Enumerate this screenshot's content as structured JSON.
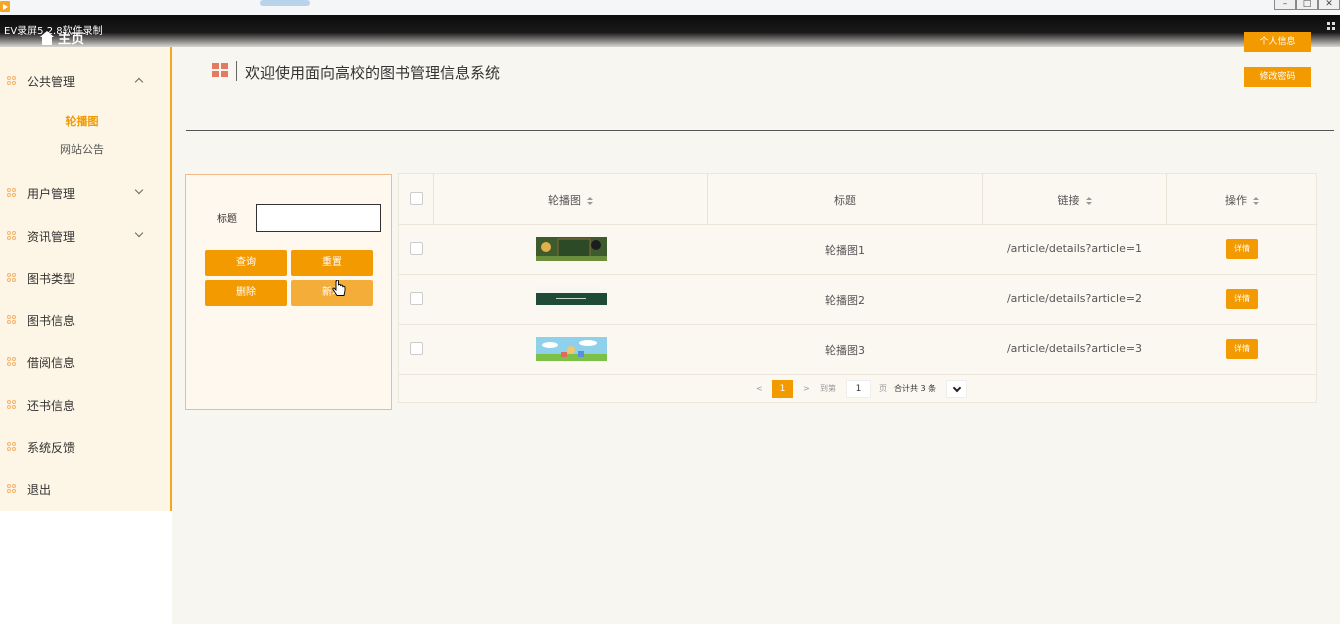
{
  "recorder": {
    "label": "EV录屏5.2.8软件录制"
  },
  "header": {
    "home_label": "主页",
    "title": "欢迎使用面向高校的图书管理信息系统",
    "profile_button": "个人信息",
    "password_button": "修改密码"
  },
  "sidebar": {
    "items": [
      {
        "label": "公共管理",
        "expanded": true,
        "children": [
          "轮播图",
          "网站公告"
        ],
        "active_child": "轮播图"
      },
      {
        "label": "用户管理",
        "expanded": false
      },
      {
        "label": "资讯管理",
        "expanded": false
      },
      {
        "label": "图书类型"
      },
      {
        "label": "图书信息"
      },
      {
        "label": "借阅信息"
      },
      {
        "label": "还书信息"
      },
      {
        "label": "系统反馈"
      },
      {
        "label": "退出"
      }
    ]
  },
  "search": {
    "title_label": "标题",
    "title_value": "",
    "query_button": "查询",
    "reset_button": "重置",
    "delete_button": "删除",
    "add_button": "新增"
  },
  "table": {
    "columns": [
      "轮播图",
      "标题",
      "链接",
      "操作"
    ],
    "rows": [
      {
        "title": "轮播图1",
        "link": "/article/details?article=1",
        "action": "详情"
      },
      {
        "title": "轮播图2",
        "link": "/article/details?article=2",
        "action": "详情"
      },
      {
        "title": "轮播图3",
        "link": "/article/details?article=3",
        "action": "详情"
      }
    ]
  },
  "pagination": {
    "prev": "<",
    "next": ">",
    "current_page": "1",
    "goto_label": "到第",
    "goto_value": "1",
    "page_unit": "页",
    "total": "合计共 3 条"
  },
  "colors": {
    "accent": "#f39a00",
    "sidebar_bg": "#fdf5e6",
    "page_bg": "#f8f6f0"
  }
}
